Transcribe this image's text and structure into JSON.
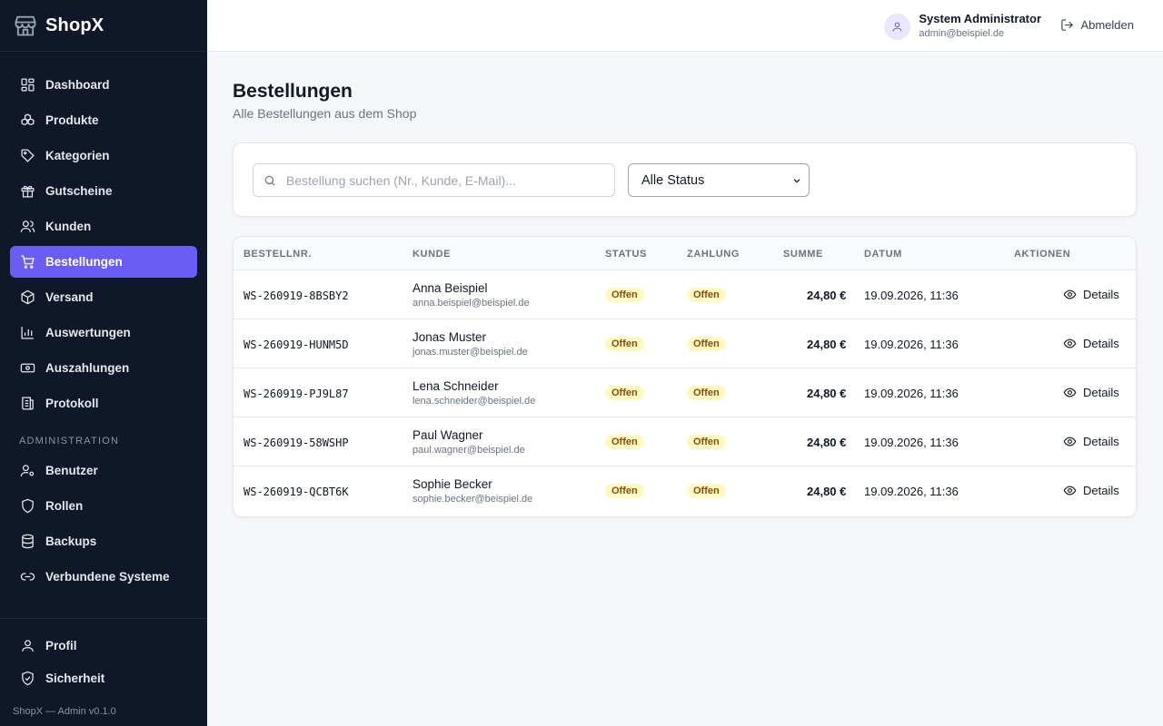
{
  "app": {
    "name": "ShopX",
    "version": "ShopX — Admin v0.1.0"
  },
  "sidebar": {
    "items": [
      {
        "label": "Dashboard",
        "icon": "dashboard-icon"
      },
      {
        "label": "Produkte",
        "icon": "products-icon"
      },
      {
        "label": "Kategorien",
        "icon": "tag-icon"
      },
      {
        "label": "Gutscheine",
        "icon": "gift-icon"
      },
      {
        "label": "Kunden",
        "icon": "users-icon"
      },
      {
        "label": "Bestellungen",
        "icon": "cart-icon",
        "active": true
      },
      {
        "label": "Versand",
        "icon": "package-icon"
      },
      {
        "label": "Auswertungen",
        "icon": "chart-icon"
      },
      {
        "label": "Auszahlungen",
        "icon": "banknote-icon"
      },
      {
        "label": "Protokoll",
        "icon": "log-icon"
      }
    ],
    "admin_section": "ADMINISTRATION",
    "admin_items": [
      {
        "label": "Benutzer",
        "icon": "user-cog-icon"
      },
      {
        "label": "Rollen",
        "icon": "shield-icon"
      },
      {
        "label": "Backups",
        "icon": "database-icon"
      },
      {
        "label": "Verbundene Systeme",
        "icon": "link-icon"
      }
    ],
    "bottom_items": [
      {
        "label": "Profil",
        "icon": "user-icon"
      },
      {
        "label": "Sicherheit",
        "icon": "shield-check-icon"
      }
    ]
  },
  "header": {
    "user_name": "System Administrator",
    "user_email": "admin@beispiel.de",
    "logout_label": "Abmelden"
  },
  "page": {
    "title": "Bestellungen",
    "subtitle": "Alle Bestellungen aus dem Shop"
  },
  "filters": {
    "search_placeholder": "Bestellung suchen (Nr., Kunde, E-Mail)...",
    "status_selected": "Alle Status"
  },
  "table": {
    "headers": [
      "BESTELLNR.",
      "KUNDE",
      "STATUS",
      "ZAHLUNG",
      "SUMME",
      "DATUM",
      "AKTIONEN"
    ],
    "rows": [
      {
        "order": "WS-260919-8BSBY2",
        "name": "Anna Beispiel",
        "email": "anna.beispiel@beispiel.de",
        "status": "Offen",
        "payment": "Offen",
        "sum": "24,80 €",
        "date": "19.09.2026, 11:36",
        "action": "Details"
      },
      {
        "order": "WS-260919-HUNM5D",
        "name": "Jonas Muster",
        "email": "jonas.muster@beispiel.de",
        "status": "Offen",
        "payment": "Offen",
        "sum": "24,80 €",
        "date": "19.09.2026, 11:36",
        "action": "Details"
      },
      {
        "order": "WS-260919-PJ9L87",
        "name": "Lena Schneider",
        "email": "lena.schneider@beispiel.de",
        "status": "Offen",
        "payment": "Offen",
        "sum": "24,80 €",
        "date": "19.09.2026, 11:36",
        "action": "Details"
      },
      {
        "order": "WS-260919-58WSHP",
        "name": "Paul Wagner",
        "email": "paul.wagner@beispiel.de",
        "status": "Offen",
        "payment": "Offen",
        "sum": "24,80 €",
        "date": "19.09.2026, 11:36",
        "action": "Details"
      },
      {
        "order": "WS-260919-QCBT6K",
        "name": "Sophie Becker",
        "email": "sophie.becker@beispiel.de",
        "status": "Offen",
        "payment": "Offen",
        "sum": "24,80 €",
        "date": "19.09.2026, 11:36",
        "action": "Details"
      }
    ]
  },
  "colors": {
    "sidebar_bg": "#0f1729",
    "accent": "#6b5cf6",
    "badge_bg": "#fef9c3",
    "badge_text": "#854d0e"
  }
}
